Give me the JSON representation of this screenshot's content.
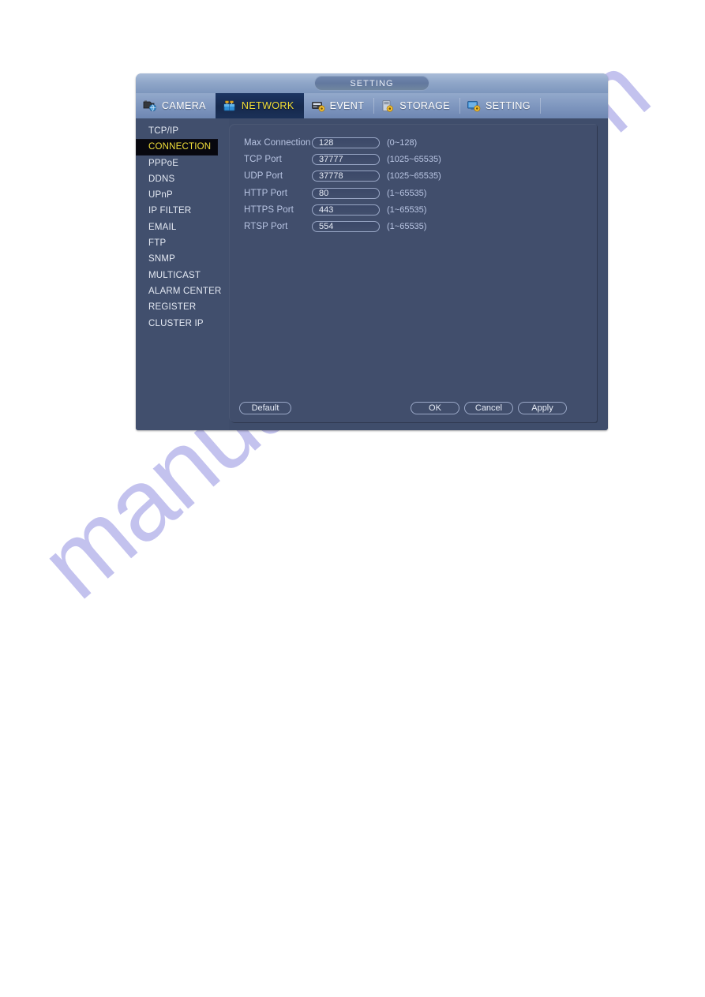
{
  "window": {
    "title": "SETTING"
  },
  "tabs": [
    {
      "label": "CAMERA",
      "icon": "camera-globe-icon",
      "active": false
    },
    {
      "label": "NETWORK",
      "icon": "network-server-icon",
      "active": true
    },
    {
      "label": "EVENT",
      "icon": "event-gear-icon",
      "active": false
    },
    {
      "label": "STORAGE",
      "icon": "storage-gear-icon",
      "active": false
    },
    {
      "label": "SETTING",
      "icon": "monitor-gear-icon",
      "active": false
    }
  ],
  "sidebar": {
    "selected": "CONNECTION",
    "items": [
      {
        "label": "TCP/IP"
      },
      {
        "label": "CONNECTION"
      },
      {
        "label": "PPPoE"
      },
      {
        "label": "DDNS"
      },
      {
        "label": "UPnP"
      },
      {
        "label": "IP FILTER"
      },
      {
        "label": "EMAIL"
      },
      {
        "label": "FTP"
      },
      {
        "label": "SNMP"
      },
      {
        "label": "MULTICAST"
      },
      {
        "label": "ALARM CENTER"
      },
      {
        "label": "REGISTER"
      },
      {
        "label": "CLUSTER IP"
      }
    ]
  },
  "form": {
    "rows": [
      {
        "label": "Max Connection",
        "value": "128",
        "hint": "(0~128)"
      },
      {
        "label": "TCP Port",
        "value": "37777",
        "hint": "(1025~65535)"
      },
      {
        "label": "UDP Port",
        "value": "37778",
        "hint": "(1025~65535)"
      },
      {
        "label": "HTTP Port",
        "value": "80",
        "hint": "(1~65535)"
      },
      {
        "label": "HTTPS Port",
        "value": "443",
        "hint": "(1~65535)"
      },
      {
        "label": "RTSP Port",
        "value": "554",
        "hint": "(1~65535)"
      }
    ]
  },
  "buttons": {
    "default_label": "Default",
    "ok_label": "OK",
    "cancel_label": "Cancel",
    "apply_label": "Apply"
  },
  "watermark": {
    "text": "manualshive.com",
    "color": "#c3c2ee"
  },
  "colors": {
    "accent_yellow": "#f3e03a",
    "panel_bg": "#414e6c",
    "sidebar_bg": "#414f6d",
    "chrome_blue": "#7f97bf",
    "selected_bg": "#07070e"
  }
}
